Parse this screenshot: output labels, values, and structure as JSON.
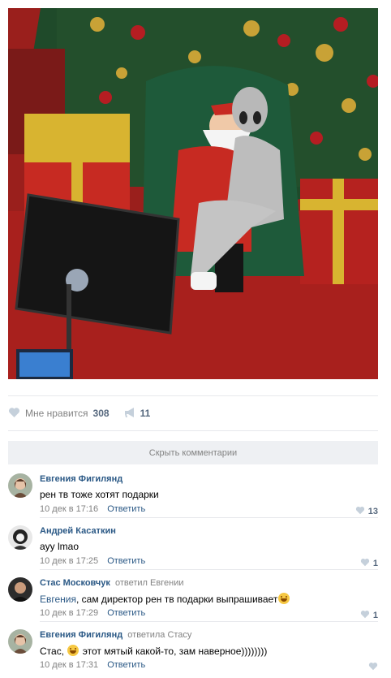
{
  "post": {
    "likes_label": "Мне нравится",
    "likes_count": "308",
    "shares_count": "11"
  },
  "comments_bar": {
    "hide_label": "Скрыть комментарии"
  },
  "comments": [
    {
      "author": "Евгения Фигилянд",
      "reply_info": "",
      "reply_to": "",
      "addressee": "",
      "text": "рен тв тоже хотят подарки",
      "date": "10 дек в 17:16",
      "reply_label": "Ответить",
      "likes": "13"
    },
    {
      "author": "Андрей Касаткин",
      "reply_info": "",
      "reply_to": "",
      "addressee": "",
      "text": "ayy lmao",
      "date": "10 дек в 17:25",
      "reply_label": "Ответить",
      "likes": "1"
    },
    {
      "author": "Стас Московчук",
      "reply_info": "ответил",
      "reply_to": "Евгении",
      "addressee": "Евгения",
      "text": ", сам директор рен тв подарки выпрашивает",
      "date": "10 дек в 17:29",
      "reply_label": "Ответить",
      "likes": "1"
    },
    {
      "author": "Евгения Фигилянд",
      "reply_info": "ответила",
      "reply_to": "Стасу",
      "addressee": "",
      "text_before": "Стас,",
      "text_after": "этот мятый какой-то, зам наверное))))))))",
      "date": "10 дек в 17:31",
      "reply_label": "Ответить",
      "likes": ""
    }
  ],
  "colors": {
    "link": "#2a5885",
    "muted": "#828282",
    "count": "#55677d",
    "separator": "#e7e8ec",
    "bar": "#eef0f3"
  },
  "icons": {
    "like": "heart-icon",
    "share": "megaphone-icon",
    "emoji": "smile-emoji-icon"
  }
}
